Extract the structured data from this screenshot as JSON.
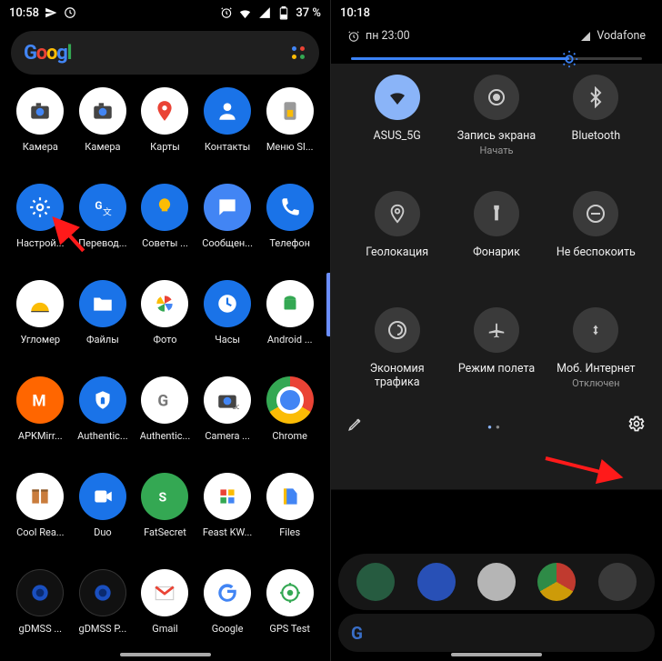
{
  "left": {
    "statusbar": {
      "time": "10:58",
      "battery": "37 %"
    },
    "apps": [
      {
        "id": "camera-1",
        "label": "Камера",
        "bg": "bg-white",
        "kind": "camera"
      },
      {
        "id": "camera-2",
        "label": "Камера",
        "bg": "bg-white",
        "kind": "camera"
      },
      {
        "id": "maps",
        "label": "Карты",
        "bg": "bg-white",
        "kind": "maps"
      },
      {
        "id": "contacts",
        "label": "Контакты",
        "bg": "bg-blue",
        "kind": "person"
      },
      {
        "id": "sim-menu",
        "label": "Меню SI...",
        "bg": "bg-white",
        "kind": "sim"
      },
      {
        "id": "settings",
        "label": "Настрой...",
        "bg": "bg-blue",
        "kind": "gear"
      },
      {
        "id": "translate",
        "label": "Перевод...",
        "bg": "bg-blue",
        "kind": "translate"
      },
      {
        "id": "tips",
        "label": "Советы ...",
        "bg": "bg-blue",
        "kind": "bulb"
      },
      {
        "id": "messages",
        "label": "Сообщен...",
        "bg": "bg-blue2",
        "kind": "msg"
      },
      {
        "id": "phone",
        "label": "Телефон",
        "bg": "bg-blue",
        "kind": "phone"
      },
      {
        "id": "protractor",
        "label": "Угломер",
        "bg": "bg-white",
        "kind": "protractor"
      },
      {
        "id": "files-app",
        "label": "Файлы",
        "bg": "bg-blue",
        "kind": "folder"
      },
      {
        "id": "photos",
        "label": "Фото",
        "bg": "bg-white",
        "kind": "pinwheel"
      },
      {
        "id": "clock",
        "label": "Часы",
        "bg": "bg-blue",
        "kind": "clock"
      },
      {
        "id": "android-sys",
        "label": "Android ...",
        "bg": "bg-white",
        "kind": "android"
      },
      {
        "id": "apkmirror",
        "label": "APKMirr...",
        "bg": "bg-orange",
        "kind": "m"
      },
      {
        "id": "authenticator-1",
        "label": "Authentic...",
        "bg": "bg-blue",
        "kind": "shield"
      },
      {
        "id": "authenticator-2",
        "label": "Authentic...",
        "bg": "bg-white",
        "kind": "g-grey"
      },
      {
        "id": "camera-go",
        "label": "Camera ...",
        "bg": "bg-white",
        "kind": "camera-go"
      },
      {
        "id": "chrome",
        "label": "Chrome",
        "bg": "bg-chrome",
        "kind": "chrome"
      },
      {
        "id": "coolreader",
        "label": "Cool Rea...",
        "bg": "bg-white",
        "kind": "book"
      },
      {
        "id": "duo",
        "label": "Duo",
        "bg": "bg-blue",
        "kind": "duo"
      },
      {
        "id": "fatsecret",
        "label": "FatSecret",
        "bg": "bg-green",
        "kind": "fs"
      },
      {
        "id": "feast",
        "label": "Feast KW...",
        "bg": "bg-white",
        "kind": "feast"
      },
      {
        "id": "files-google",
        "label": "Files",
        "bg": "bg-white",
        "kind": "files-g"
      },
      {
        "id": "gdmss-1",
        "label": "gDMSS ...",
        "bg": "bg-black",
        "kind": "camera-lens"
      },
      {
        "id": "gdmss-2",
        "label": "gDMSS P...",
        "bg": "bg-black",
        "kind": "camera-lens"
      },
      {
        "id": "gmail",
        "label": "Gmail",
        "bg": "bg-white",
        "kind": "gmail"
      },
      {
        "id": "google",
        "label": "Google",
        "bg": "bg-white",
        "kind": "g-color"
      },
      {
        "id": "gps-test",
        "label": "GPS Test",
        "bg": "bg-white",
        "kind": "gps"
      }
    ]
  },
  "right": {
    "statusbar": {
      "time": "10:18"
    },
    "alarm_text": "пн 23:00",
    "carrier": "Vodafone",
    "brightness_percent": 75,
    "tiles": [
      {
        "id": "wifi",
        "label": "ASUS_5G",
        "sub": "",
        "active": true,
        "kind": "wifi"
      },
      {
        "id": "screenrec",
        "label": "Запись экрана",
        "sub": "Начать",
        "active": false,
        "kind": "target"
      },
      {
        "id": "bluetooth",
        "label": "Bluetooth",
        "sub": "",
        "active": false,
        "kind": "bt"
      },
      {
        "id": "location",
        "label": "Геолокация",
        "sub": "",
        "active": false,
        "kind": "pin"
      },
      {
        "id": "flashlight",
        "label": "Фонарик",
        "sub": "",
        "active": false,
        "kind": "torch"
      },
      {
        "id": "dnd",
        "label": "Не беспокоить",
        "sub": "",
        "active": false,
        "kind": "dnd"
      },
      {
        "id": "datasaver",
        "label": "Экономия трафика",
        "sub": "",
        "active": false,
        "kind": "data"
      },
      {
        "id": "airplane",
        "label": "Режим полета",
        "sub": "",
        "active": false,
        "kind": "plane"
      },
      {
        "id": "mobiledata",
        "label": "Моб. Интернет",
        "sub": "Отключен",
        "active": false,
        "kind": "cell"
      }
    ]
  }
}
